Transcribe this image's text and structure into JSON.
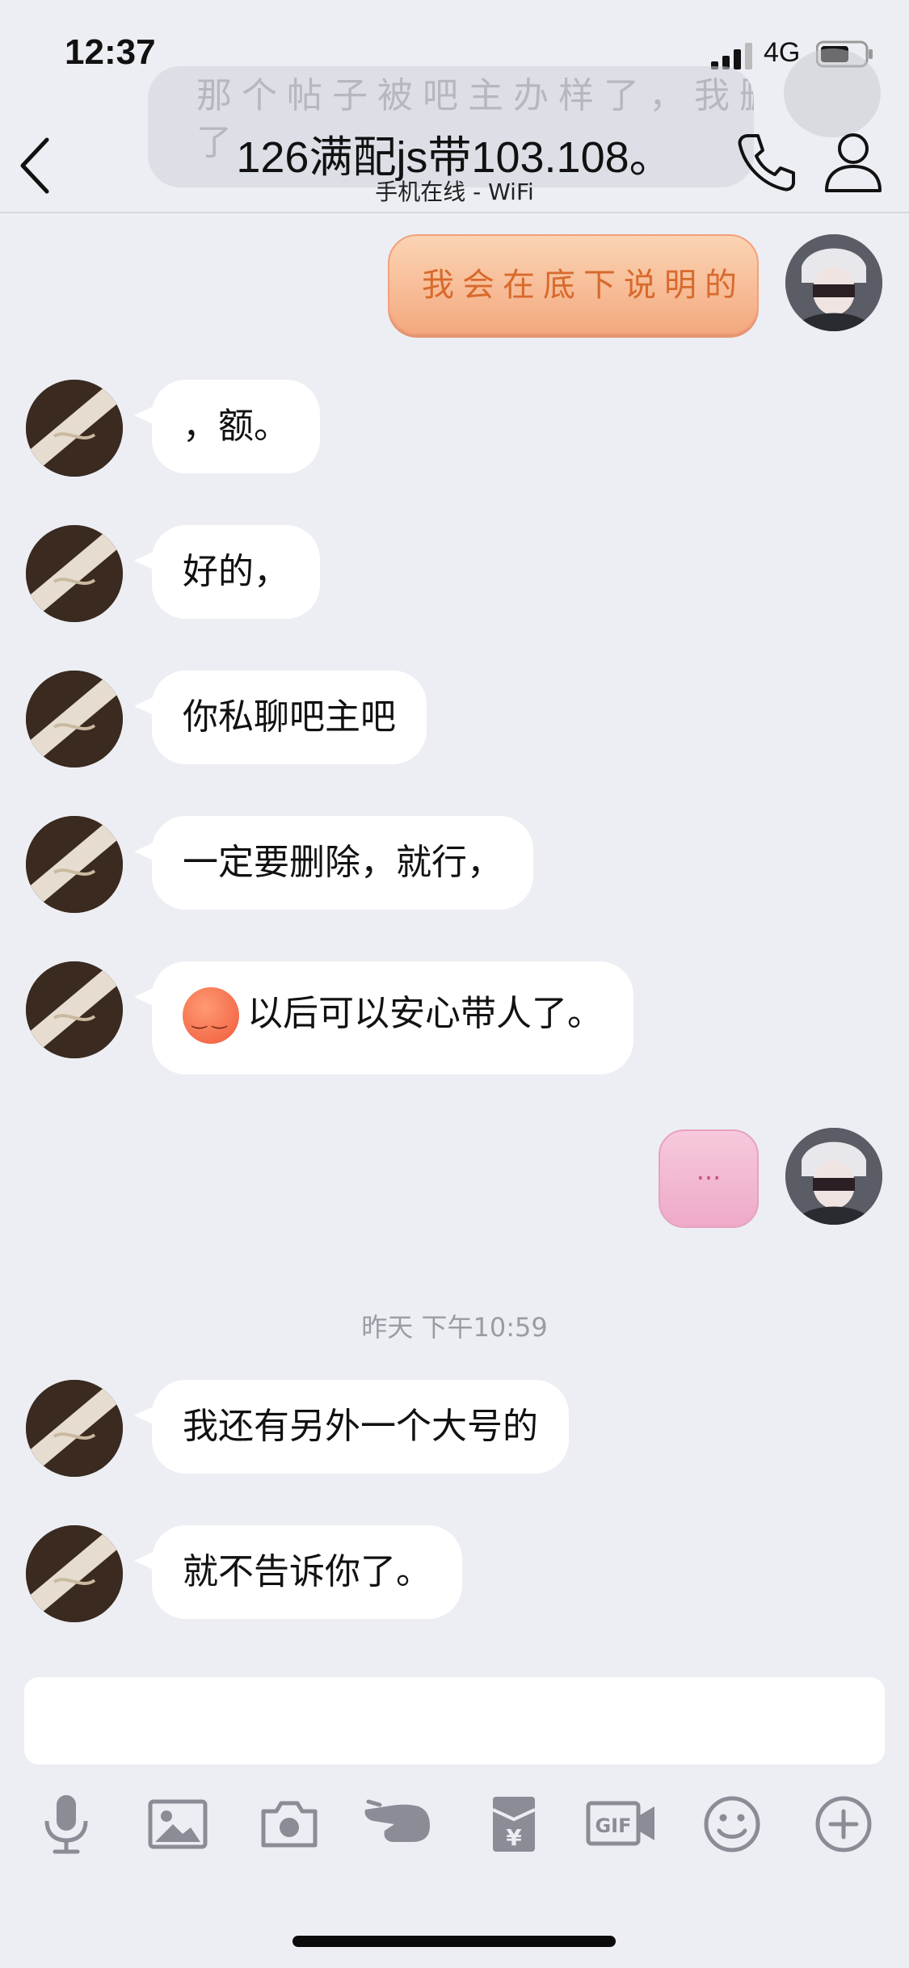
{
  "status_bar": {
    "time": "12:37",
    "network": "4G"
  },
  "notification": {
    "line1": "那个帖子被吧主办样了，我删不",
    "line2": "了"
  },
  "header": {
    "title": "126满配js带103.108。",
    "subtitle": "手机在线 - WiFi"
  },
  "messages": [
    {
      "side": "right",
      "style": "orange-bubble",
      "text": "我会在底下说明的"
    },
    {
      "side": "left",
      "text": "，额。"
    },
    {
      "side": "left",
      "text": "好的，"
    },
    {
      "side": "left",
      "text": "你私聊吧主吧"
    },
    {
      "side": "left",
      "text": "一定要删除，就行，"
    },
    {
      "side": "left",
      "emoji": "sleepy-face",
      "text": "以后可以安心带人了。"
    },
    {
      "side": "right",
      "style": "pink-bubble",
      "text": "..."
    },
    {
      "type": "timestamp",
      "text": "昨天 下午10:59"
    },
    {
      "side": "left",
      "text": "我还有另外一个大号的"
    },
    {
      "side": "left",
      "text": "就不告诉你了。"
    }
  ],
  "toolbar": [
    "microphone-icon",
    "image-icon",
    "camera-icon",
    "poke-hand-icon",
    "red-packet-icon",
    "gif-icon",
    "emoji-icon",
    "plus-icon"
  ],
  "colors": {
    "background": "#eceef3",
    "bubble": "#ffffff",
    "orange_bubble": "#f4a97f",
    "pink_bubble": "#eeaac9",
    "icon_gray": "#8a8d96"
  }
}
